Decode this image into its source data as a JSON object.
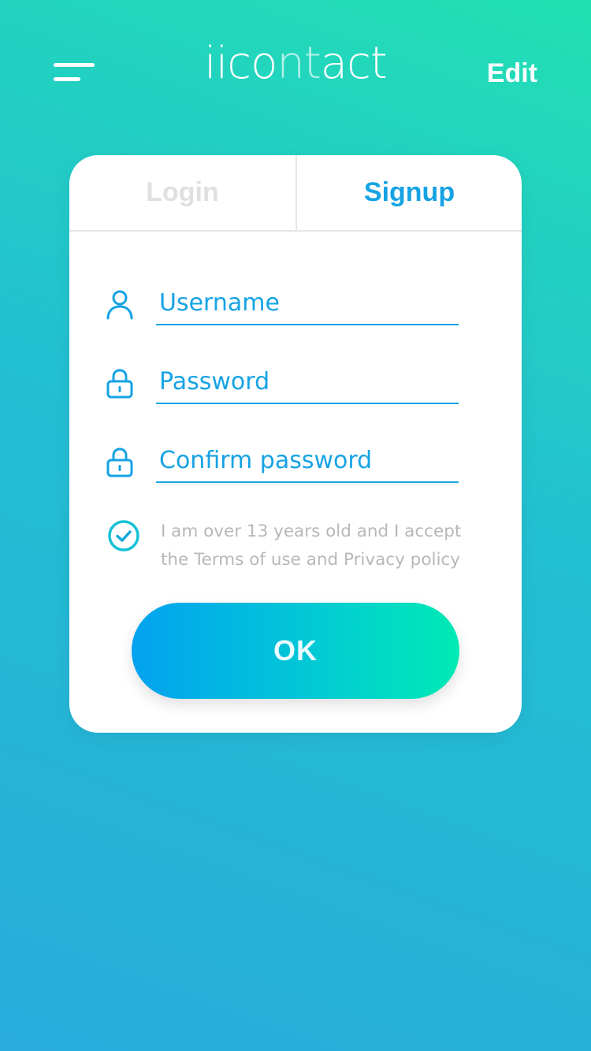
{
  "header": {
    "menu_icon": "hamburger-menu-icon",
    "logo_part_a": "iico",
    "logo_part_b": "nt",
    "logo_part_c": "act",
    "edit_label": "Edit"
  },
  "tabs": {
    "login_label": "Login",
    "signup_label": "Signup",
    "active": "Signup"
  },
  "form": {
    "username": {
      "placeholder": "Username",
      "value": "",
      "icon": "user-icon"
    },
    "password": {
      "placeholder": "Password",
      "value": "",
      "icon": "lock-icon"
    },
    "confirm_password": {
      "placeholder": "Confirm password",
      "value": "",
      "icon": "lock-icon"
    },
    "consent": {
      "checked": true,
      "icon": "check-circle-icon",
      "line1": "I am over 13 years old and I accept",
      "line2": "the Terms of use and Privacy policy"
    },
    "submit_label": "OK"
  },
  "colors": {
    "accent": "#16a3e4",
    "check": "#14c1d4",
    "button_gradient_start": "#03a2f0",
    "button_gradient_end": "#00eab4",
    "inactive_tab": "#e0e0e0",
    "muted_text": "#b8b8b8"
  }
}
